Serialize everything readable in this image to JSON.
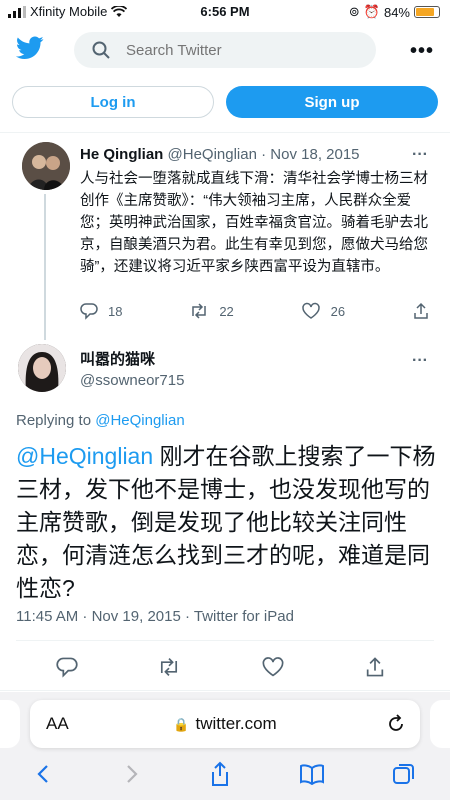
{
  "status_bar": {
    "carrier": "Xfinity Mobile",
    "time": "6:56 PM",
    "battery": "84%",
    "battery_level": 0.84
  },
  "header": {
    "search_placeholder": "Search Twitter",
    "more_label": "•••"
  },
  "auth": {
    "login_label": "Log in",
    "signup_label": "Sign up"
  },
  "parent_tweet": {
    "name": "He Qinglian",
    "handle": "@HeQinglian",
    "separator": " · ",
    "date": "Nov 18, 2015",
    "text": "人与社会一堕落就成直线下滑：清华社会学博士杨三材创作《主席赞歌》：“伟大领袖习主席，人民群众全爱您；英明神武治国家，百姓幸福贪官泣。骑着毛驴去北京，自酿美酒只为君。此生有幸见到您，愿做犬马给您骑”，还建议将习近平家乡陕西富平设为直辖市。",
    "replies": "18",
    "retweets": "22",
    "likes": "26"
  },
  "main_tweet": {
    "name": "叫嚣的猫咪",
    "handle": "@ssowneor715",
    "replying_prefix": "Replying to ",
    "replying_to": "@HeQinglian",
    "mention": "@HeQinglian",
    "text": " 刚才在谷歌上搜索了一下杨三材，发下他不是博士，也没发现他写的主席赞歌，倒是发现了他比较关注同性恋，何清涟怎么找到三才的呢，难道是同性恋?",
    "meta": "11:45 AM · Nov 19, 2015 · Twitter for iPad"
  },
  "safari": {
    "text_size_label": "AA",
    "url": "twitter.com"
  },
  "colors": {
    "twitter_blue": "#1d9bf0",
    "secondary_text": "#536471",
    "battery": "#f5a623"
  }
}
